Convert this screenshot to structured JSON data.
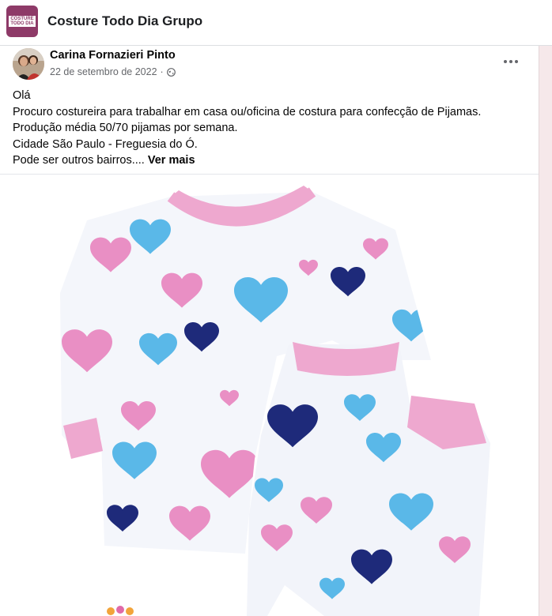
{
  "group": {
    "name": "Costure Todo Dia Grupo",
    "logo_text": "COSTURE TODO DIA",
    "logo_subtext": "GRUPO"
  },
  "post": {
    "author": "Carina Fornazieri Pinto",
    "date": "22 de setembro de 2022",
    "separator": "·",
    "privacy_icon": "globe-icon",
    "more_icon": "more-options-icon",
    "lines": [
      "Olá",
      "Procuro costureira para trabalhar em casa ou/oficina de costura para confecção de Pijamas.",
      "Produção média 50/70 pijamas por semana.",
      "Cidade São Paulo - Freguesia do Ó."
    ],
    "last_line": "Pode ser outros bairros....",
    "see_more": "Ver mais"
  },
  "colors": {
    "brand": "#8e3a68",
    "pajama_pink": "#e98fc4",
    "pajama_blue": "#5ab8e8",
    "pajama_navy": "#1e2a7a",
    "cuff_pink": "#eea8cf"
  }
}
